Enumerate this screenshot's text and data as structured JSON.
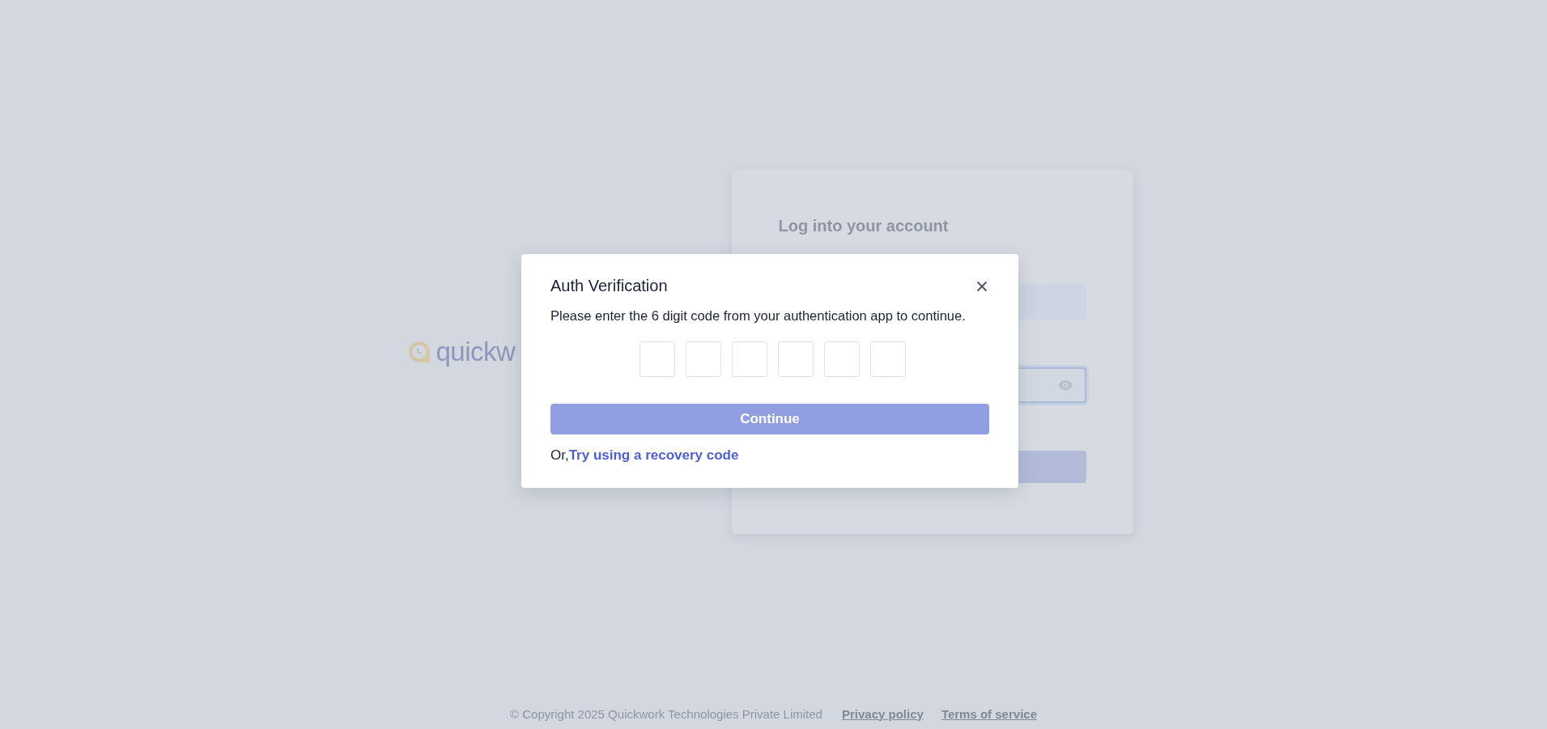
{
  "logo": {
    "text": "quickw"
  },
  "login_card": {
    "title": "Log into your account",
    "fields": [
      {
        "kind": "text",
        "focused": false
      },
      {
        "kind": "password",
        "focused": true
      }
    ]
  },
  "modal": {
    "title": "Auth Verification",
    "message": "Please enter the 6 digit code from your authentication app to continue.",
    "code_fields": [
      {
        "kind": "digit"
      },
      {
        "kind": "digit"
      },
      {
        "kind": "digit"
      },
      {
        "kind": "digit"
      },
      {
        "kind": "digit"
      },
      {
        "kind": "digit"
      }
    ],
    "button": "Continue",
    "alternative_prefix": "Or,",
    "alternative_link": "Try using a recovery code"
  },
  "footer": {
    "copyright": "© Copyright 2025 Quickwork Technologies Private Limited",
    "links": [
      "Privacy policy",
      "Terms of service"
    ]
  }
}
